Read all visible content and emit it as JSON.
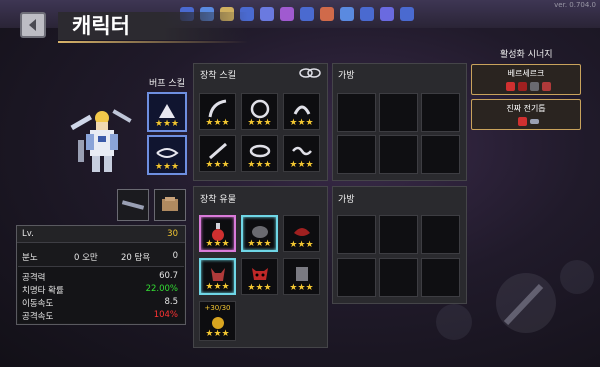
{
  "version": "ver. 0.704.0",
  "header": {
    "title": "캐릭터"
  },
  "buff_skill": {
    "label": "버프 스킬"
  },
  "equip_skill": {
    "label": "장착 스킬",
    "slots": [
      {
        "stars": [
          "★",
          "★",
          "★"
        ]
      },
      {
        "stars": [
          "★",
          "★",
          "★"
        ]
      },
      {
        "stars": [
          "★",
          "★",
          "★"
        ]
      },
      {
        "stars": [
          "★",
          "★",
          "★"
        ]
      },
      {
        "stars": [
          "★",
          "★",
          "★"
        ]
      },
      {
        "stars": [
          "★",
          "★",
          "★"
        ]
      }
    ]
  },
  "equip_relic": {
    "label": "장착 유물",
    "counter": "+30/30",
    "slots": [
      {
        "stars": [
          "★",
          "★",
          "★"
        ]
      },
      {
        "stars": [
          "★",
          "★",
          "★"
        ]
      },
      {
        "stars": [
          "★",
          "★",
          "★"
        ]
      },
      {
        "stars": [
          "★",
          "★",
          "★"
        ]
      },
      {
        "stars": [
          "★",
          "★",
          "★"
        ]
      },
      {
        "stars": [
          "★",
          "★",
          "★"
        ]
      },
      {
        "stars": [
          "★",
          "★",
          "★"
        ]
      }
    ]
  },
  "bags": {
    "top_label": "가방",
    "bottom_label": "가방"
  },
  "synergy": {
    "title": "활성화 시너지",
    "items": [
      {
        "name": "베르세르크"
      },
      {
        "name": "진짜 전기톱"
      }
    ]
  },
  "stats": {
    "level_label": "Lv.",
    "level_value": "30",
    "anger_label": "분노",
    "anger_value": "0 오만",
    "pride_value": "20 탐욕",
    "greed_value": "0",
    "attack_label": "공격력",
    "attack_value": "60.7",
    "crit_label": "치명타 확률",
    "crit_value": "22.00%",
    "move_label": "이동속도",
    "move_value": "8.5",
    "atkspd_label": "공격속도",
    "atkspd_value": "104%"
  },
  "colors": {
    "gold": "#f2c632",
    "green": "#33dd33",
    "red": "#ff3333",
    "pink": "#d97ad9",
    "cyan": "#6fd6e6",
    "synergy_border": "#c9a35c"
  }
}
